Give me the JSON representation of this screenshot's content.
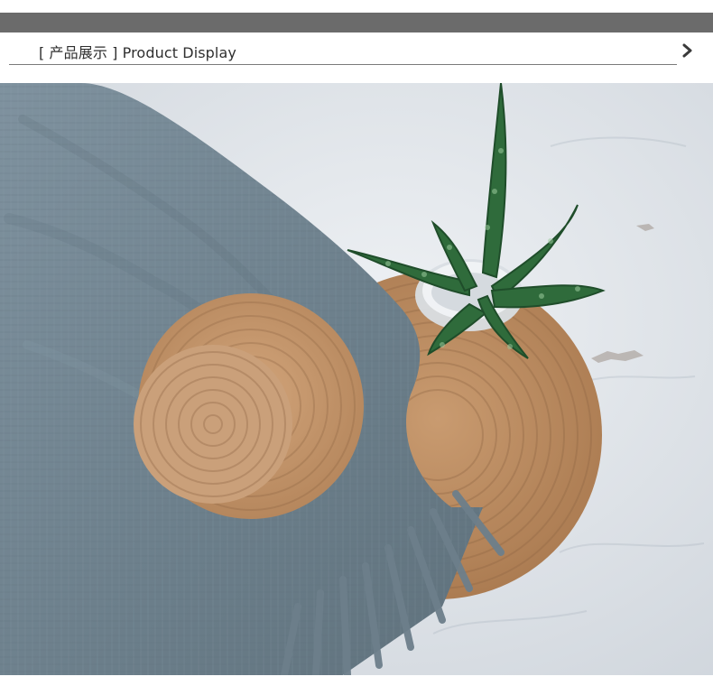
{
  "header": {
    "section_title": "[ 产品展示 ] Product Display"
  },
  "icons": {
    "next": "chevron-right-icon"
  },
  "colors": {
    "top_band": "#6b6b6b",
    "divider": "#7a7a7a",
    "title_text": "#2f2f2f",
    "chevron": "#3a3a3a",
    "background_surface": "#dfe3e8",
    "blanket": "#6f828f",
    "jute": "#b98a5f",
    "plant": "#2f6b3b"
  }
}
